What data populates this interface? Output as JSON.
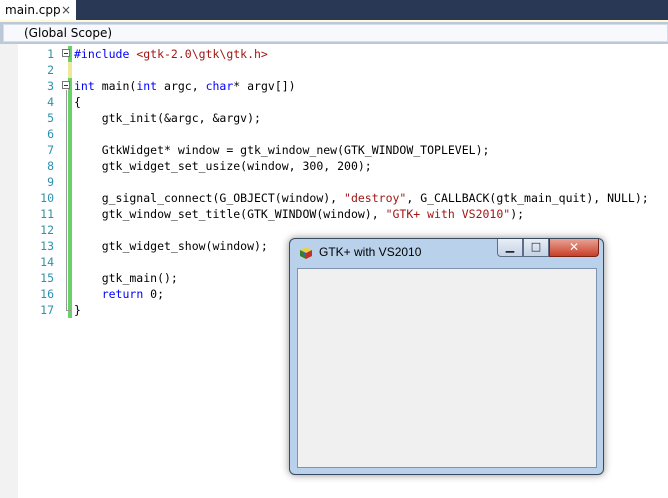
{
  "tab": {
    "label": "main.cpp",
    "close_glyph": "×"
  },
  "navbar": {
    "scope": "(Global Scope)"
  },
  "colors": {
    "tabstrip_bg": "#293955",
    "keyword": "#0000ff",
    "string": "#a31515",
    "line_number": "#2b91af",
    "change_saved": "#6ad06a"
  },
  "code_lines": [
    {
      "n": "1",
      "segments": [
        {
          "t": "#include ",
          "c": "kw"
        },
        {
          "t": "<gtk-2.0\\gtk\\gtk.h>",
          "c": "str"
        }
      ]
    },
    {
      "n": "2",
      "segments": []
    },
    {
      "n": "3",
      "segments": [
        {
          "t": "int",
          "c": "kw"
        },
        {
          "t": " main("
        },
        {
          "t": "int",
          "c": "kw"
        },
        {
          "t": " argc, "
        },
        {
          "t": "char",
          "c": "kw"
        },
        {
          "t": "* argv[])"
        }
      ]
    },
    {
      "n": "4",
      "segments": [
        {
          "t": "{"
        }
      ]
    },
    {
      "n": "5",
      "segments": [
        {
          "t": "    gtk_init(&argc, &argv);"
        }
      ]
    },
    {
      "n": "6",
      "segments": []
    },
    {
      "n": "7",
      "segments": [
        {
          "t": "    GtkWidget* window = gtk_window_new(GTK_WINDOW_TOPLEVEL);"
        }
      ]
    },
    {
      "n": "8",
      "segments": [
        {
          "t": "    gtk_widget_set_usize(window, 300, 200);"
        }
      ]
    },
    {
      "n": "9",
      "segments": []
    },
    {
      "n": "10",
      "segments": [
        {
          "t": "    g_signal_connect(G_OBJECT(window), "
        },
        {
          "t": "\"destroy\"",
          "c": "str"
        },
        {
          "t": ", G_CALLBACK(gtk_main_quit), NULL);"
        }
      ]
    },
    {
      "n": "11",
      "segments": [
        {
          "t": "    gtk_window_set_title(GTK_WINDOW(window), "
        },
        {
          "t": "\"GTK+ with VS2010\"",
          "c": "str"
        },
        {
          "t": ");"
        }
      ]
    },
    {
      "n": "12",
      "segments": []
    },
    {
      "n": "13",
      "segments": [
        {
          "t": "    gtk_widget_show(window);"
        }
      ]
    },
    {
      "n": "14",
      "segments": []
    },
    {
      "n": "15",
      "segments": [
        {
          "t": "    gtk_main();"
        }
      ]
    },
    {
      "n": "16",
      "segments": [
        {
          "t": "    "
        },
        {
          "t": "return",
          "c": "kw"
        },
        {
          "t": " 0;"
        }
      ]
    },
    {
      "n": "17",
      "segments": [
        {
          "t": "}"
        }
      ]
    }
  ],
  "gtk_window": {
    "title": "GTK+ with VS2010",
    "icon": "gtk-cube-icon",
    "buttons": {
      "minimize": "▁",
      "maximize": "□",
      "close": "✕"
    }
  }
}
